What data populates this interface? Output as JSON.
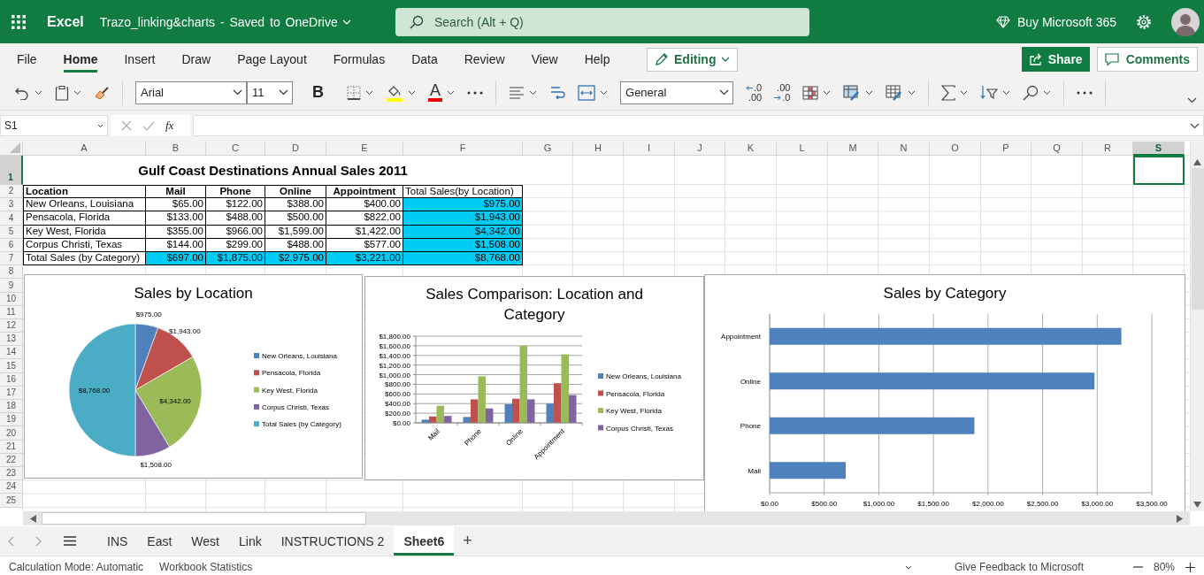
{
  "app_bar": {
    "app_name": "Excel",
    "document": "Trazo_linking&charts - Saved to OneDrive",
    "search": {
      "placeholder": "Search (Alt + Q)"
    },
    "buy_label": "Buy Microsoft 365"
  },
  "ribbon_tabs": [
    {
      "label": "File",
      "selected": false
    },
    {
      "label": "Home",
      "selected": true
    },
    {
      "label": "Insert",
      "selected": false
    },
    {
      "label": "Draw",
      "selected": false
    },
    {
      "label": "Page Layout",
      "selected": false
    },
    {
      "label": "Formulas",
      "selected": false
    },
    {
      "label": "Data",
      "selected": false
    },
    {
      "label": "Review",
      "selected": false
    },
    {
      "label": "View",
      "selected": false
    },
    {
      "label": "Help",
      "selected": false
    }
  ],
  "mode_button": "Editing",
  "share_button": "Share",
  "comments_button": "Comments",
  "toolbar": {
    "font": "Arial",
    "font_size": "11",
    "bold_label": "B",
    "font_color_label": "A",
    "number_format": "General",
    "decimal_buttons": [
      {
        "kind": "increase",
        "top": ".0",
        "bottom": ".00"
      },
      {
        "kind": "decrease",
        "top": ".00",
        "bottom": ".0"
      }
    ]
  },
  "formula_bar": {
    "name_box": "S1",
    "function_label": "fx"
  },
  "sheet": {
    "columns": [
      {
        "label": "A",
        "selected": false
      },
      {
        "label": "B",
        "selected": false
      },
      {
        "label": "C",
        "selected": false
      },
      {
        "label": "D",
        "selected": false
      },
      {
        "label": "E",
        "selected": false
      },
      {
        "label": "F",
        "selected": false
      },
      {
        "label": "G",
        "selected": false
      },
      {
        "label": "H",
        "selected": false
      },
      {
        "label": "I",
        "selected": false
      },
      {
        "label": "J",
        "selected": false
      },
      {
        "label": "K",
        "selected": false
      },
      {
        "label": "L",
        "selected": false
      },
      {
        "label": "M",
        "selected": false
      },
      {
        "label": "N",
        "selected": false
      },
      {
        "label": "O",
        "selected": false
      },
      {
        "label": "P",
        "selected": false
      },
      {
        "label": "Q",
        "selected": false
      },
      {
        "label": "R",
        "selected": false
      },
      {
        "label": "S",
        "selected": true
      }
    ],
    "rows": [
      {
        "label": "1",
        "selected": true
      },
      {
        "label": "2",
        "selected": false
      },
      {
        "label": "3",
        "selected": false
      },
      {
        "label": "4",
        "selected": false
      },
      {
        "label": "5",
        "selected": false
      },
      {
        "label": "6",
        "selected": false
      },
      {
        "label": "7",
        "selected": false
      },
      {
        "label": "8",
        "selected": false
      },
      {
        "label": "9",
        "selected": false
      },
      {
        "label": "10",
        "selected": false
      },
      {
        "label": "11",
        "selected": false
      },
      {
        "label": "12",
        "selected": false
      },
      {
        "label": "13",
        "selected": false
      },
      {
        "label": "14",
        "selected": false
      },
      {
        "label": "15",
        "selected": false
      },
      {
        "label": "16",
        "selected": false
      },
      {
        "label": "17",
        "selected": false
      },
      {
        "label": "18",
        "selected": false
      },
      {
        "label": "19",
        "selected": false
      },
      {
        "label": "20",
        "selected": false
      },
      {
        "label": "21",
        "selected": false
      },
      {
        "label": "22",
        "selected": false
      },
      {
        "label": "23",
        "selected": false
      },
      {
        "label": "24",
        "selected": false
      },
      {
        "label": "25",
        "selected": false
      }
    ],
    "title": "Gulf Coast Destinations Annual Sales 2011",
    "table": {
      "header": [
        {
          "text": "Location",
          "bold": true
        },
        {
          "text": "Mail",
          "bold": true
        },
        {
          "text": "Phone",
          "bold": true
        },
        {
          "text": "Online",
          "bold": true
        },
        {
          "text": "Appointment",
          "bold": true
        },
        {
          "text": "Total Sales(by Location)",
          "bold": false
        }
      ],
      "rows": [
        {
          "cells": [
            {
              "text": "New Orleans, Louisiana",
              "highlighted": false
            },
            {
              "text": "$65.00",
              "highlighted": false
            },
            {
              "text": "$122.00",
              "highlighted": false
            },
            {
              "text": "$388.00",
              "highlighted": false
            },
            {
              "text": "$400.00",
              "highlighted": false
            },
            {
              "text": "$975.00",
              "highlighted": true
            }
          ]
        },
        {
          "cells": [
            {
              "text": "Pensacola, Florida",
              "highlighted": false
            },
            {
              "text": "$133.00",
              "highlighted": false
            },
            {
              "text": "$488.00",
              "highlighted": false
            },
            {
              "text": "$500.00",
              "highlighted": false
            },
            {
              "text": "$822.00",
              "highlighted": false
            },
            {
              "text": "$1,943.00",
              "highlighted": true
            }
          ]
        },
        {
          "cells": [
            {
              "text": "Key West, Florida",
              "highlighted": false
            },
            {
              "text": "$355.00",
              "highlighted": false
            },
            {
              "text": "$966.00",
              "highlighted": false
            },
            {
              "text": "$1,599.00",
              "highlighted": false
            },
            {
              "text": "$1,422.00",
              "highlighted": false
            },
            {
              "text": "$4,342.00",
              "highlighted": true
            }
          ]
        },
        {
          "cells": [
            {
              "text": "Corpus Christi, Texas",
              "highlighted": false
            },
            {
              "text": "$144.00",
              "highlighted": false
            },
            {
              "text": "$299.00",
              "highlighted": false
            },
            {
              "text": "$488.00",
              "highlighted": false
            },
            {
              "text": "$577.00",
              "highlighted": false
            },
            {
              "text": "$1,508.00",
              "highlighted": true
            }
          ]
        },
        {
          "cells": [
            {
              "text": "Total Sales (by Category)",
              "highlighted": false
            },
            {
              "text": "$697.00",
              "highlighted": true
            },
            {
              "text": "$1,875.00",
              "highlighted": true
            },
            {
              "text": "$2,975.00",
              "highlighted": true
            },
            {
              "text": "$3,221.00",
              "highlighted": true
            },
            {
              "text": "$8,768.00",
              "highlighted": true
            }
          ]
        }
      ]
    }
  },
  "charts": [
    {
      "chart_data": {
        "type": "pie",
        "title": "Sales by Location",
        "categories": [
          "New Orleans, Louisiana",
          "Pensacola, Florida",
          "Key West, Florida",
          "Corpus Christi, Texas",
          "Total Sales (by Category)"
        ],
        "values": [
          975,
          1943,
          4342,
          1508,
          8768
        ],
        "value_labels": [
          "$975.00",
          "$1,943.00",
          "$4,342.00",
          "$1,508.00",
          "$8,768.00"
        ],
        "legend": true
      }
    },
    {
      "chart_data": {
        "type": "bar",
        "title": "Sales Comparison: Location and Category",
        "categories": [
          "Mail",
          "Phone",
          "Online",
          "Appointment"
        ],
        "series": [
          {
            "name": "New Orleans, Louisiana",
            "color": "#4f81bd",
            "values": [
              65,
              122,
              388,
              400
            ]
          },
          {
            "name": "Pensacola, Florida",
            "color": "#c0504d",
            "values": [
              133,
              488,
              500,
              822
            ]
          },
          {
            "name": "Key West, Florida",
            "color": "#9bbb59",
            "values": [
              355,
              966,
              1599,
              1422
            ]
          },
          {
            "name": "Corpus Christi, Texas",
            "color": "#8064a2",
            "values": [
              144,
              299,
              488,
              577
            ]
          }
        ],
        "ylim": [
          0,
          1800
        ],
        "yticks": [
          {
            "value": 0,
            "label": "$0.00"
          },
          {
            "value": 200,
            "label": "$200.00"
          },
          {
            "value": 400,
            "label": "$400.00"
          },
          {
            "value": 600,
            "label": "$600.00"
          },
          {
            "value": 800,
            "label": "$800.00"
          },
          {
            "value": 1000,
            "label": "$1,000.00"
          },
          {
            "value": 1200,
            "label": "$1,200.00"
          },
          {
            "value": 1400,
            "label": "$1,400.00"
          },
          {
            "value": 1600,
            "label": "$1,600.00"
          },
          {
            "value": 1800,
            "label": "$1,800.00"
          }
        ],
        "legend": true,
        "grid": true
      }
    },
    {
      "chart_data": {
        "type": "bar",
        "orientation": "horizontal",
        "title": "Sales by Category",
        "categories": [
          "Appointment",
          "Online",
          "Phone",
          "Mail"
        ],
        "values": [
          3221,
          2975,
          1875,
          697
        ],
        "xlim": [
          0,
          3500
        ],
        "xticks": [
          {
            "value": 0,
            "label": "$0.00"
          },
          {
            "value": 500,
            "label": "$500.00"
          },
          {
            "value": 1000,
            "label": "$1,000.00"
          },
          {
            "value": 1500,
            "label": "$1,500.00"
          },
          {
            "value": 2000,
            "label": "$2,000.00"
          },
          {
            "value": 2500,
            "label": "$2,500.00"
          },
          {
            "value": 3000,
            "label": "$3,000.00"
          },
          {
            "value": 3500,
            "label": "$3,500.00"
          }
        ],
        "grid": true
      }
    }
  ],
  "sheet_tabs": [
    {
      "label": "INS",
      "selected": false
    },
    {
      "label": "East",
      "selected": false
    },
    {
      "label": "West",
      "selected": false
    },
    {
      "label": "Link",
      "selected": false
    },
    {
      "label": "INSTRUCTIONS 2",
      "selected": false
    },
    {
      "label": "Sheet6",
      "selected": true
    }
  ],
  "add_sheet": "+",
  "status_bar": {
    "calculation": "Calculation Mode: Automatic",
    "statistics": "Workbook Statistics",
    "feedback": "Give Feedback to Microsoft",
    "zoom": "80%"
  }
}
